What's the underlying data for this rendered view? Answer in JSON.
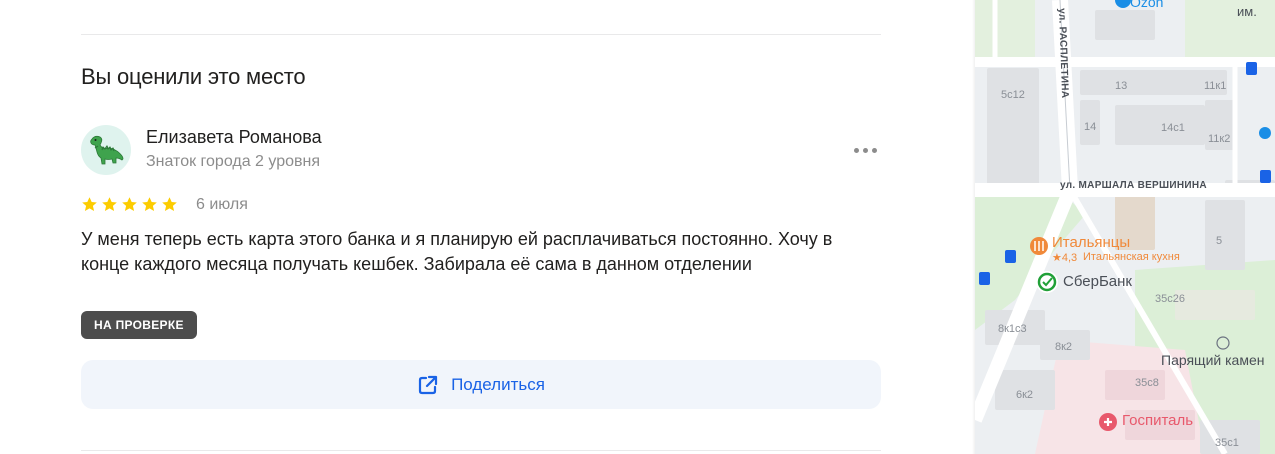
{
  "section": {
    "title": "Вы оценили это место"
  },
  "review": {
    "author_name": "Елизавета Романова",
    "author_level": "Знаток города 2 уровня",
    "rating": 5,
    "date": "6 июля",
    "text": "У меня теперь есть карта этого банка и я планирую ей расплачиваться постоянно. Хочу в конце каждого месяца получать кешбек. Забирала её сама в данном отделении",
    "status": "НА ПРОВЕРКЕ",
    "share_label": "Поделиться"
  },
  "colors": {
    "star": "#fccc00",
    "accent": "#1a63e6",
    "badge_bg": "#4d4d4d",
    "share_bg": "#f1f5fb",
    "sber": "#21a038",
    "food": "#f0893a",
    "hospital": "#e8596c"
  },
  "icons": {
    "avatar": "dinosaur-icon",
    "more": "more-dots-icon",
    "share": "share-icon"
  },
  "map": {
    "streets": [
      "ул. РАСПЛЕТИНА",
      "ул. МАРШАЛА ВЕРШИНИНА"
    ],
    "top_partial": {
      "ozon": "Ozon",
      "im": "им."
    },
    "building_numbers": [
      "13",
      "11к1",
      "5с12",
      "14",
      "14с1",
      "11к2",
      "5",
      "35с26",
      "8к1с3",
      "8к2",
      "35с8",
      "6к2",
      "35с1"
    ],
    "pois": {
      "italian": {
        "name": "Итальянцы",
        "rating": "★4,3",
        "category": "Итальянская кухня"
      },
      "sber": {
        "name": "СберБанк"
      },
      "park": {
        "name": "Парящий камен"
      },
      "hospital": {
        "name": "Госпиталь"
      }
    }
  }
}
